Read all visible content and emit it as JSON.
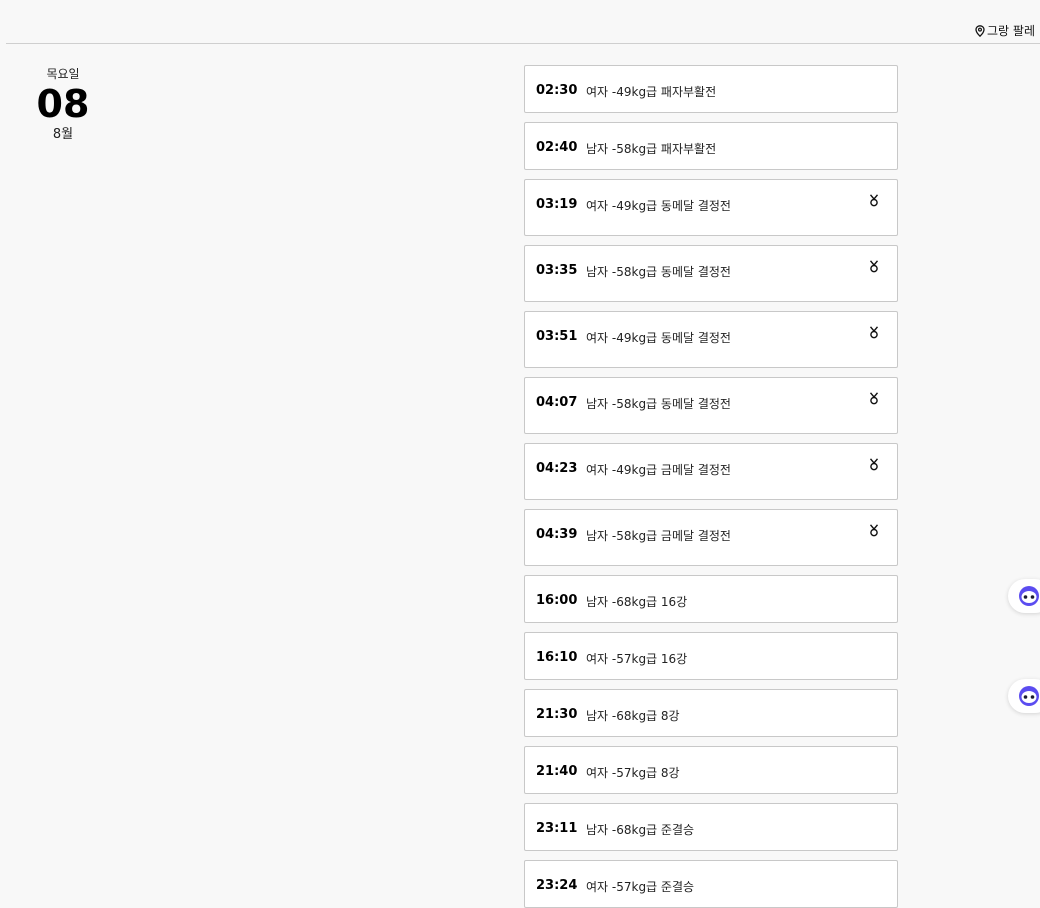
{
  "venue": {
    "label": "그랑 팔레",
    "icon": "map-pin-icon"
  },
  "date": {
    "weekday": "목요일",
    "day": "08",
    "month": "8월"
  },
  "events": [
    {
      "time": "02:30",
      "title": "여자 -49kg급 패자부활전",
      "medal": false
    },
    {
      "time": "02:40",
      "title": "남자 -58kg급 패자부활전",
      "medal": false
    },
    {
      "time": "03:19",
      "title": "여자 -49kg급 동메달 결정전",
      "medal": true
    },
    {
      "time": "03:35",
      "title": "남자 -58kg급 동메달 결정전",
      "medal": true
    },
    {
      "time": "03:51",
      "title": "여자 -49kg급 동메달 결정전",
      "medal": true
    },
    {
      "time": "04:07",
      "title": "남자 -58kg급 동메달 결정전",
      "medal": true
    },
    {
      "time": "04:23",
      "title": "여자 -49kg급 금메달 결정전",
      "medal": true
    },
    {
      "time": "04:39",
      "title": "남자 -58kg급 금메달 결정전",
      "medal": true
    },
    {
      "time": "16:00",
      "title": "남자 -68kg급 16강",
      "medal": false
    },
    {
      "time": "16:10",
      "title": "여자 -57kg급 16강",
      "medal": false
    },
    {
      "time": "21:30",
      "title": "남자 -68kg급 8강",
      "medal": false
    },
    {
      "time": "21:40",
      "title": "여자 -57kg급 8강",
      "medal": false
    },
    {
      "time": "23:11",
      "title": "남자 -68kg급 준결승",
      "medal": false
    },
    {
      "time": "23:24",
      "title": "여자 -57kg급 준결승",
      "medal": false
    }
  ],
  "floating_buttons": [
    {
      "icon": "chatbot-icon"
    },
    {
      "icon": "chatbot-icon"
    }
  ],
  "colors": {
    "background": "#f8f8f8",
    "card_border": "#c8c8c8",
    "chatbot_accent": "#5b4cf0"
  }
}
